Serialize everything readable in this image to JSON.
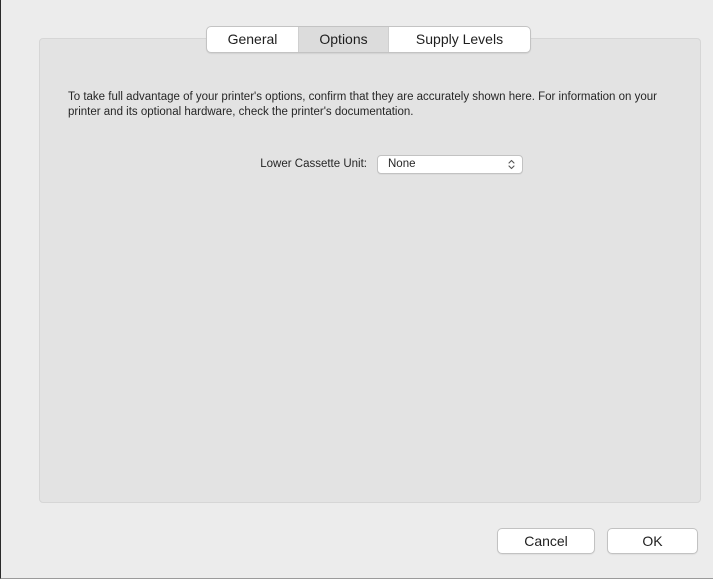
{
  "tabs": [
    {
      "label": "General",
      "selected": false
    },
    {
      "label": "Options",
      "selected": true
    },
    {
      "label": "Supply Levels",
      "selected": false
    }
  ],
  "options": {
    "description": "To take full advantage of your printer's options, confirm that they are accurately shown here. For information on your printer and its optional hardware, check the printer's documentation.",
    "lower_cassette_label": "Lower Cassette Unit:",
    "lower_cassette_value": "None"
  },
  "footer": {
    "cancel_label": "Cancel",
    "ok_label": "OK"
  },
  "colors": {
    "window_bg": "#ececec",
    "group_bg": "#e3e3e3",
    "selected_tab_bg": "#dcdcdc"
  }
}
